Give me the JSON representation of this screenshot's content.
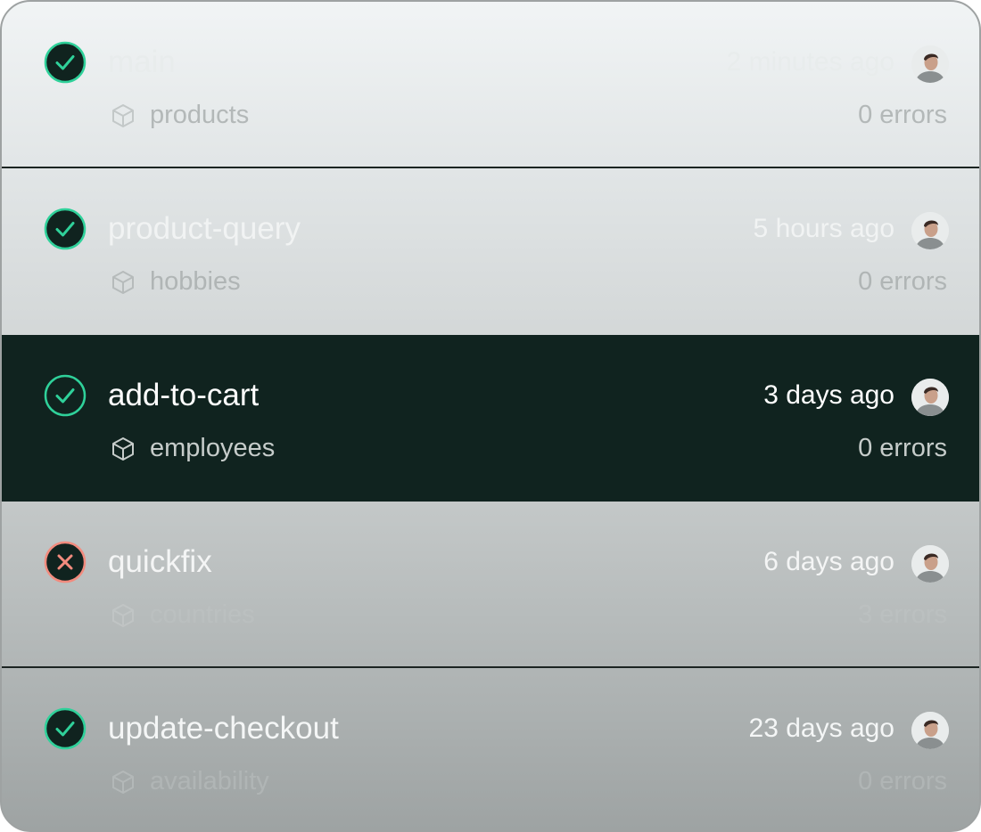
{
  "colors": {
    "success": "#2fd19a",
    "success_fill": "#10231f",
    "error": "#f28b7e",
    "error_fill": "#10231f",
    "selected_row": "#10231f"
  },
  "deployments": [
    {
      "name": "main",
      "time": "2 minutes ago",
      "model": "products",
      "errors": "0 errors",
      "status": "success",
      "status_icon": "check-circle-icon",
      "selected": false
    },
    {
      "name": "product-query",
      "time": "5 hours ago",
      "model": "hobbies",
      "errors": "0 errors",
      "status": "success",
      "status_icon": "check-circle-icon",
      "selected": false
    },
    {
      "name": "add-to-cart",
      "time": "3 days ago",
      "model": "employees",
      "errors": "0 errors",
      "status": "success",
      "status_icon": "check-circle-icon",
      "selected": true
    },
    {
      "name": "quickfix",
      "time": "6 days ago",
      "model": "countries",
      "errors": "3 errors",
      "status": "failed",
      "status_icon": "x-circle-icon",
      "selected": false
    },
    {
      "name": "update-checkout",
      "time": "23 days ago",
      "model": "availability",
      "errors": "0 errors",
      "status": "success",
      "status_icon": "check-circle-icon",
      "selected": false
    }
  ],
  "icons": {
    "model": "cube-icon",
    "author": "avatar"
  }
}
